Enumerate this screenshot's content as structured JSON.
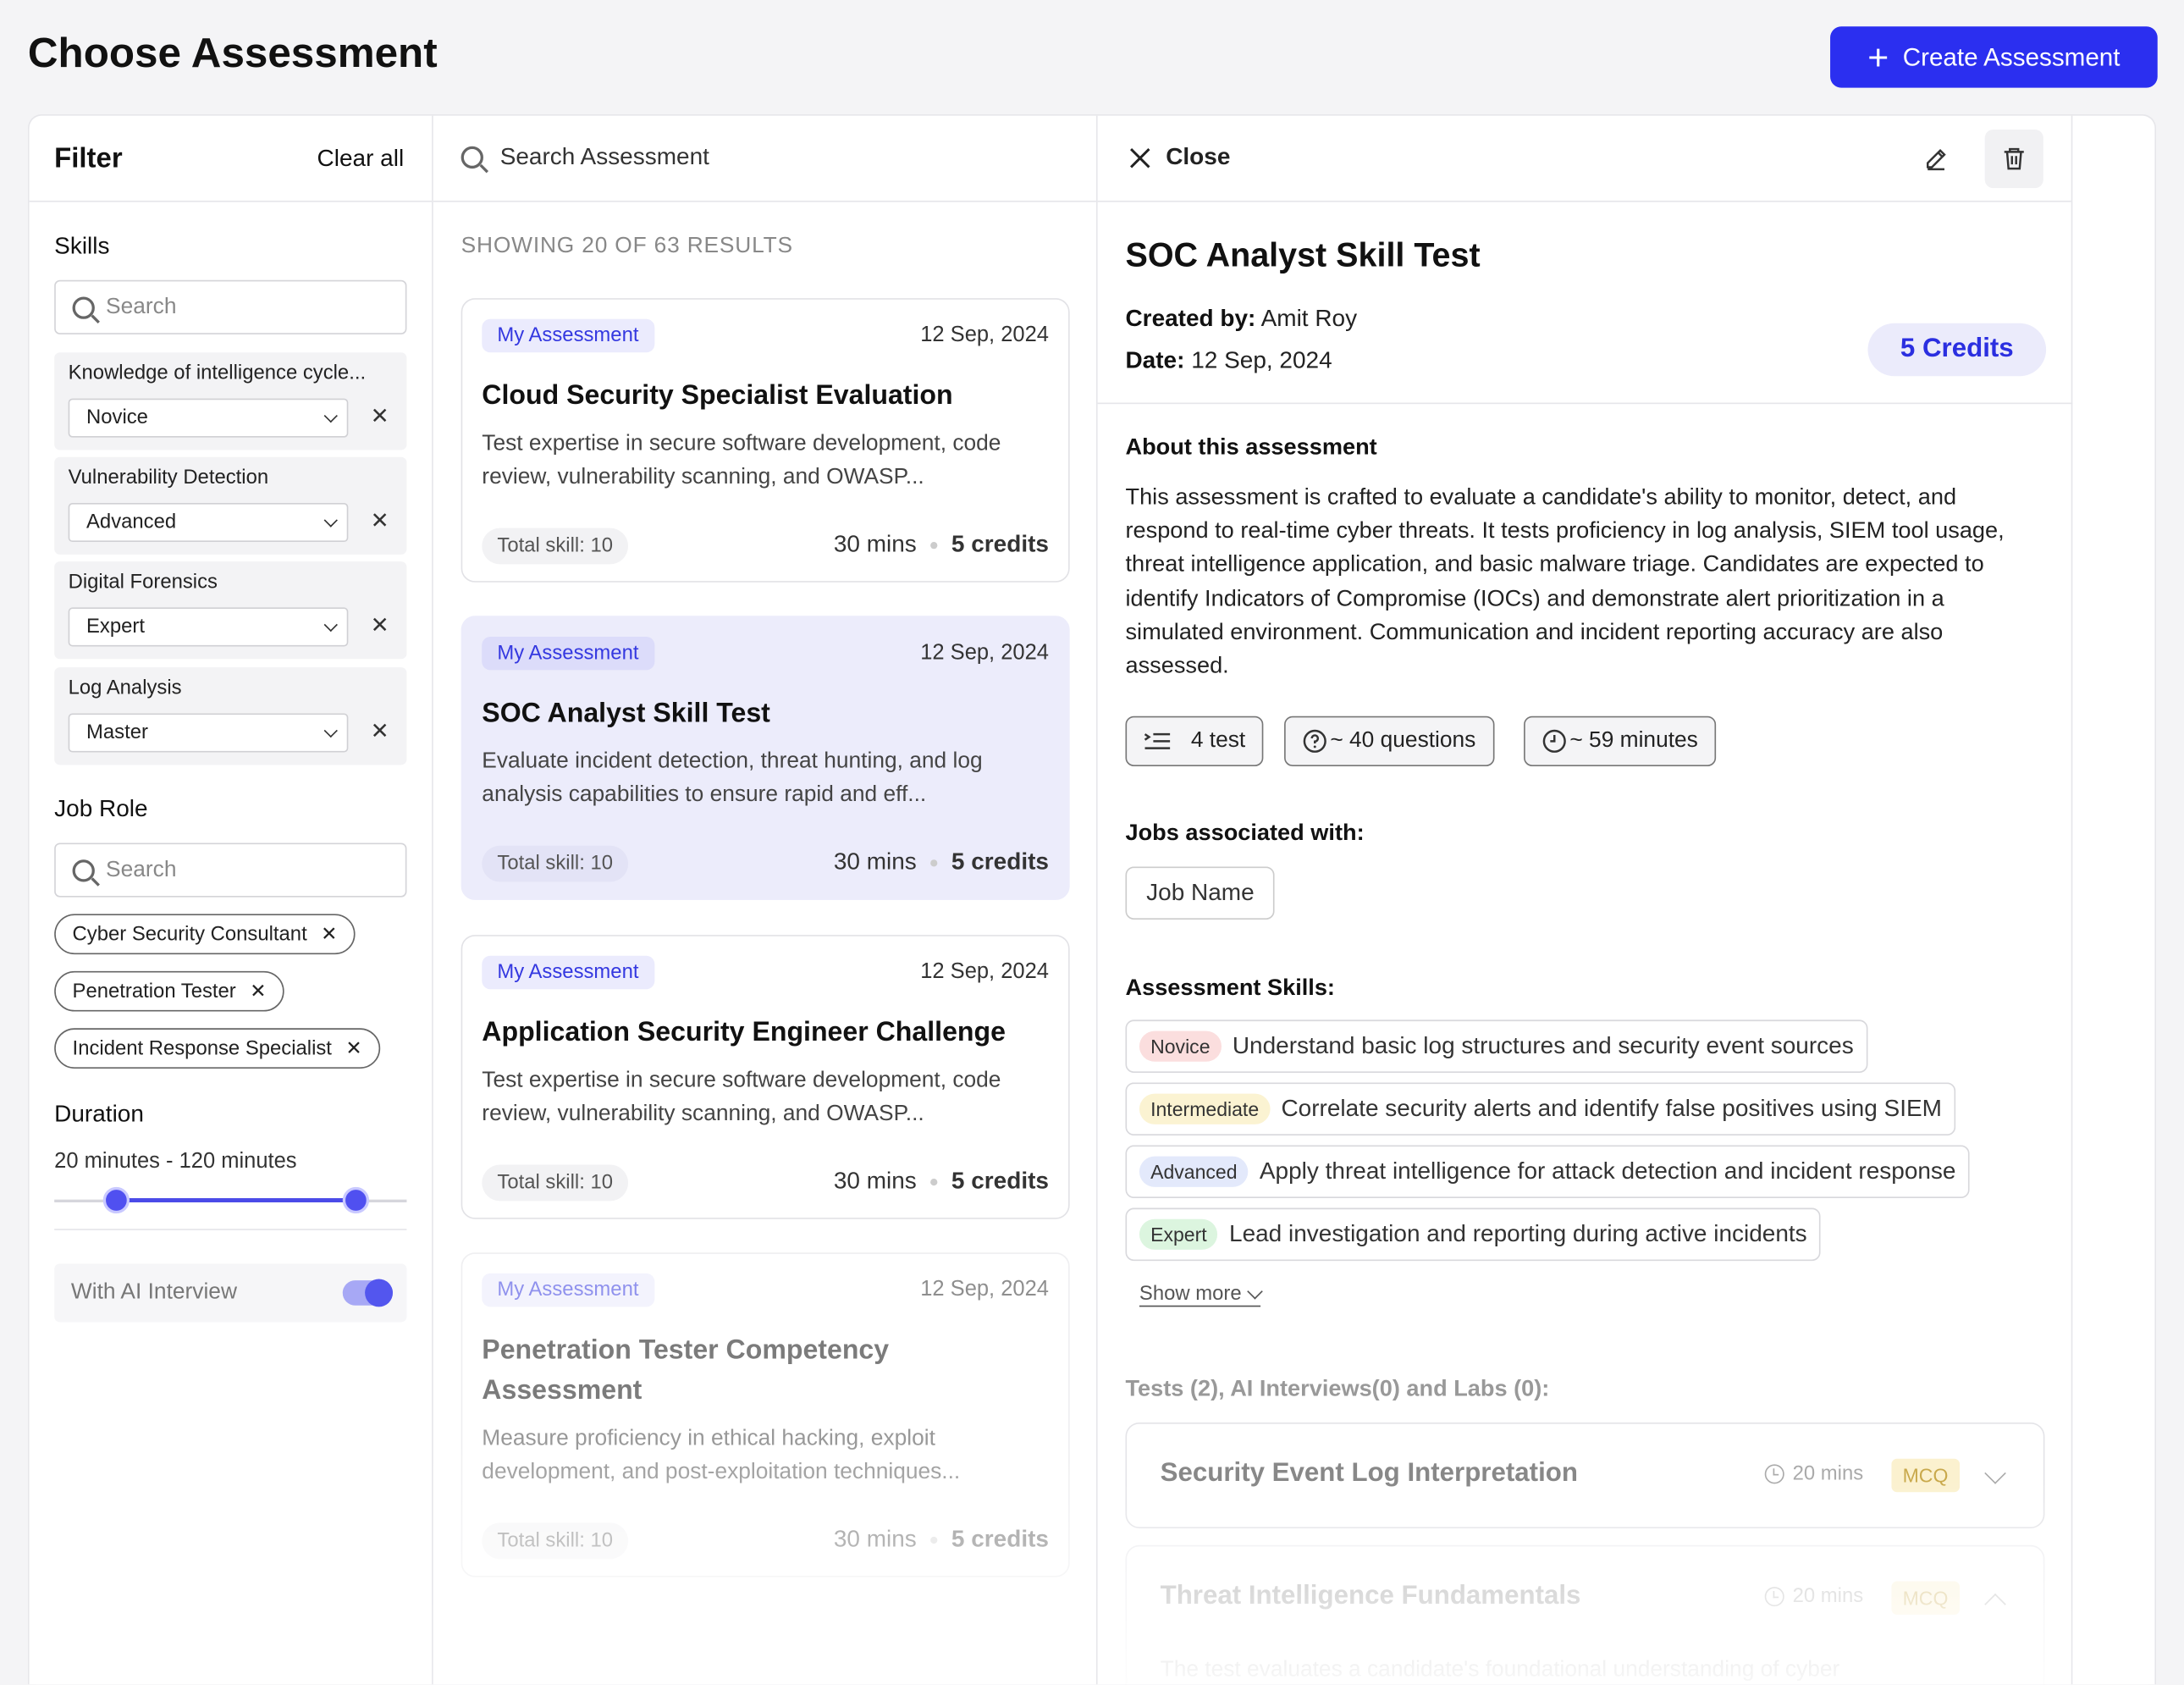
{
  "page_title": "Choose Assessment",
  "create_button": "Create Assessment",
  "filter": {
    "title": "Filter",
    "clear_all": "Clear all",
    "skills_label": "Skills",
    "skills_search_placeholder": "Search",
    "skills": [
      {
        "name": "Knowledge of intelligence cycle...",
        "level": "Novice"
      },
      {
        "name": "Vulnerability Detection",
        "level": "Advanced"
      },
      {
        "name": "Digital Forensics",
        "level": "Expert"
      },
      {
        "name": "Log Analysis",
        "level": "Master"
      }
    ],
    "job_role_label": "Job Role",
    "job_search_placeholder": "Search",
    "job_roles": [
      "Cyber Security Consultant",
      "Penetration Tester",
      "Incident Response Specialist"
    ],
    "duration_label": "Duration",
    "duration_range": "20 minutes - 120 minutes",
    "duration_min": 20,
    "duration_max": 120,
    "ai_interview_label": "With AI Interview",
    "ai_interview_on": true
  },
  "list": {
    "search_placeholder": "Search Assessment",
    "showing": "SHOWING 20 OF 63 RESULTS",
    "cards": [
      {
        "badge": "My Assessment",
        "date": "12 Sep, 2024",
        "title": "Cloud Security Specialist Evaluation",
        "desc": "Test expertise in secure software development, code review, vulnerability scanning, and OWASP...",
        "total": "Total skill: 10",
        "mins": "30 mins",
        "credits": "5 credits"
      },
      {
        "badge": "My Assessment",
        "date": "12 Sep, 2024",
        "title": "SOC Analyst Skill Test",
        "desc": "Evaluate incident detection, threat hunting, and log analysis capabilities to ensure rapid and eff...",
        "total": "Total skill: 10",
        "mins": "30 mins",
        "credits": "5 credits"
      },
      {
        "badge": "My Assessment",
        "date": "12 Sep, 2024",
        "title": "Application Security Engineer Challenge",
        "desc": "Test expertise in secure software development, code review, vulnerability scanning, and OWASP...",
        "total": "Total skill: 10",
        "mins": "30 mins",
        "credits": "5 credits"
      },
      {
        "badge": "My Assessment",
        "date": "12 Sep, 2024",
        "title": "Penetration Tester Competency Assessment",
        "desc": "Measure proficiency in ethical hacking, exploit development, and post-exploitation techniques...",
        "total": "Total skill: 10",
        "mins": "30 mins",
        "credits": "5 credits"
      }
    ]
  },
  "detail": {
    "close": "Close",
    "title": "SOC Analyst Skill Test",
    "created_by_label": "Created by:",
    "created_by": "Amit Roy",
    "date_label": "Date:",
    "date": "12 Sep, 2024",
    "credits": "5 Credits",
    "about_label": "About this assessment",
    "about": "This assessment is crafted to evaluate a candidate's ability to monitor, detect, and respond to real-time cyber threats. It tests proficiency in log analysis, SIEM tool usage, threat intelligence application, and basic malware triage. Candidates are expected to identify Indicators of Compromise (IOCs) and demonstrate alert prioritization in a simulated environment. Communication and incident reporting accuracy are also assessed.",
    "stats": {
      "tests": "4 test",
      "questions": "~ 40 questions",
      "minutes": "~ 59 minutes"
    },
    "jobs_label": "Jobs associated with:",
    "job_name": "Job Name",
    "skills_label": "Assessment Skills:",
    "skills": [
      {
        "level": "Novice",
        "text": "Understand basic log structures and security event sources",
        "color": "#fbdede"
      },
      {
        "level": "Intermediate",
        "text": "Correlate security alerts and identify false positives using SIEM",
        "color": "#fbf3d2"
      },
      {
        "level": "Advanced",
        "text": "Apply threat intelligence for attack detection and incident response",
        "color": "#e3e9fb"
      },
      {
        "level": "Expert",
        "text": "Lead investigation and reporting during active incidents",
        "color": "#dcf5df"
      }
    ],
    "show_more": "Show more",
    "tests_heading": "Tests (2), AI Interviews(0) and Labs (0):",
    "tests": [
      {
        "title": "Security Event Log Interpretation",
        "mins": "20 mins",
        "type": "MCQ"
      },
      {
        "title": "Threat Intelligence Fundamentals",
        "mins": "20 mins",
        "type": "MCQ"
      }
    ],
    "tests_overflow": "The test evaluates a candidate's foundational understanding of cyber"
  }
}
